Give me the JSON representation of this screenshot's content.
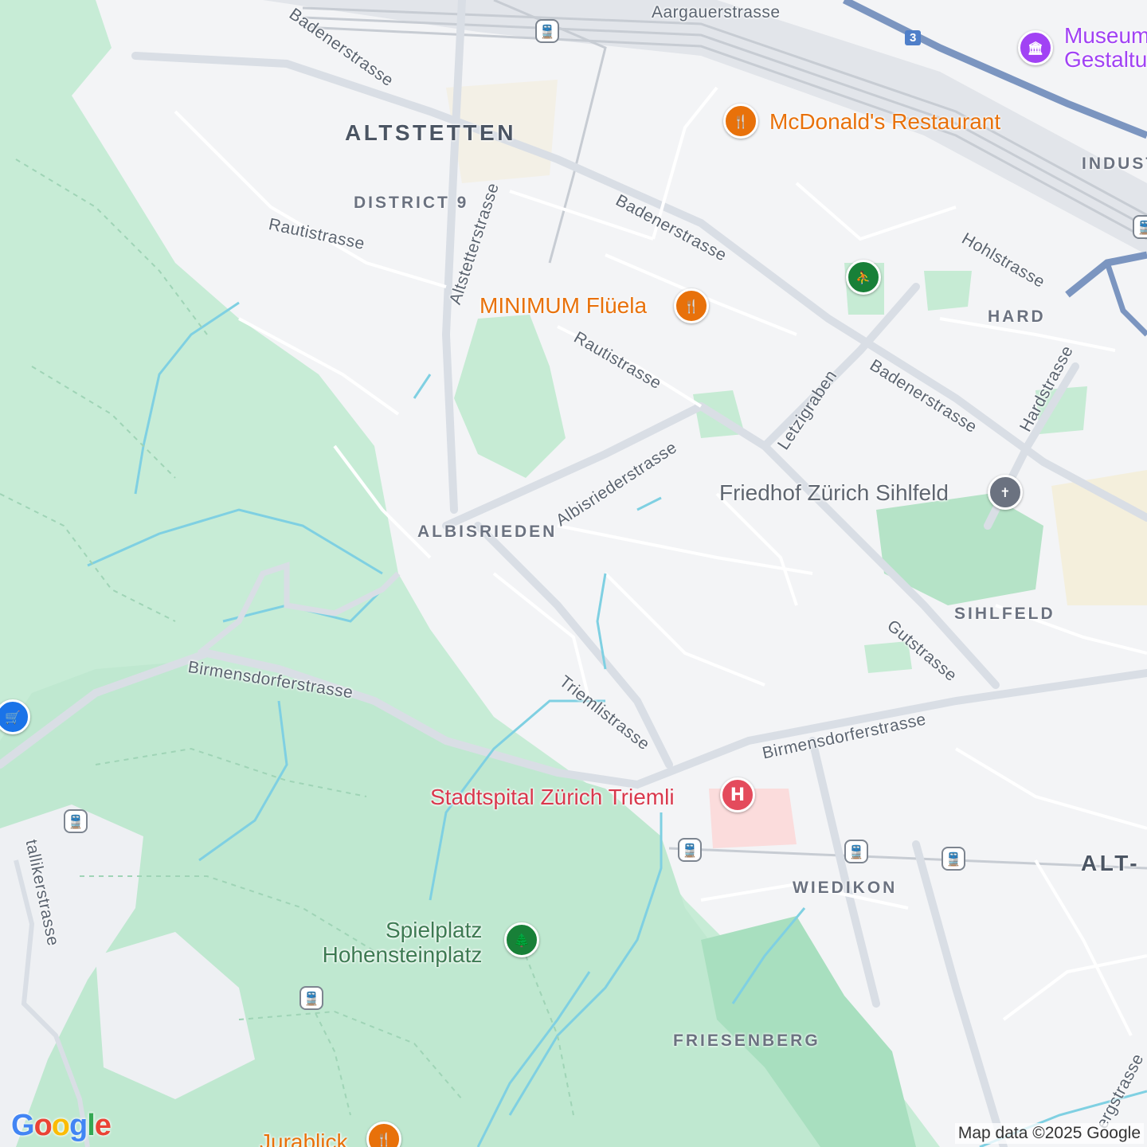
{
  "map": {
    "colors": {
      "background": "#f3f4f6",
      "park": "#c8ecd7",
      "forest": "#b9e6cc",
      "water": "#7dd3e3",
      "road": "#ffffff",
      "major_road": "#d6dbe2",
      "highway": "#6b87b5",
      "rail": "#bfc5cd"
    },
    "districts": {
      "altstetten": "ALTSTETTEN",
      "district9": "DISTRICT 9",
      "albisrieden": "ALBISRIEDEN",
      "hard": "HARD",
      "indust": "INDUST",
      "sihlfeld": "SIHLFELD",
      "wiedikon": "WIEDIKON",
      "friesenberg": "FRIESENBERG",
      "alt_w": "ALT-"
    },
    "streets": {
      "aargauerstrasse": "Aargauerstrasse",
      "badenerstrasse_1": "Badenerstrasse",
      "badenerstrasse_2": "Badenerstrasse",
      "badenerstrasse_3": "Badenerstrasse",
      "rautistrasse_1": "Rautistrasse",
      "rautistrasse_2": "Rautistrasse",
      "altstetterstrasse": "Altstetterstrasse",
      "hohlstrasse": "Hohlstrasse",
      "letzigraben": "Letzigraben",
      "hardstrasse": "Hardstrasse",
      "albisriederstrasse": "Albisriederstrasse",
      "birmensdorferstrasse_1": "Birmensdorferstrasse",
      "birmensdorferstrasse_2": "Birmensdorferstrasse",
      "triemlistrasse": "Triemlistrasse",
      "gutstrasse": "Gutstrasse",
      "uetlibergstrasse_partial": "ergstrasse",
      "stallikerstrasse_partial": "tallikerstrasse"
    },
    "pois": {
      "mcdonalds": {
        "name": "McDonald's Restaurant",
        "icon": "fork-knife-icon",
        "color": "#e8710a"
      },
      "minimum": {
        "name": "MINIMUM Flüela",
        "icon": "fork-knife-icon",
        "color": "#e8710a"
      },
      "museum": {
        "name_line1": "Museum",
        "name_line2": "Gestaltu",
        "icon": "museum-icon",
        "color": "#a142f4"
      },
      "friedhof": {
        "name": "Friedhof Zürich Sihlfeld",
        "icon": "cemetery-icon",
        "color": "#6b7280"
      },
      "triemli": {
        "name": "Stadtspital Zürich Triemli",
        "icon": "hospital-icon",
        "color": "#e44b5c",
        "glyph": "H"
      },
      "spielplatz": {
        "name_line1": "Spielplatz",
        "name_line2": "Hohensteinplatz",
        "icon": "tree-icon",
        "color": "#188038"
      },
      "jurablick": {
        "name": "Jurablick",
        "icon": "fork-knife-icon",
        "color": "#e8710a"
      },
      "sports": {
        "icon": "sports-icon",
        "color": "#188038"
      },
      "shopping": {
        "icon": "shopping-cart-icon",
        "color": "#1a73e8"
      }
    },
    "highway_shield": "3",
    "attribution": "Map data ©2025 Google",
    "logo": "Google"
  }
}
